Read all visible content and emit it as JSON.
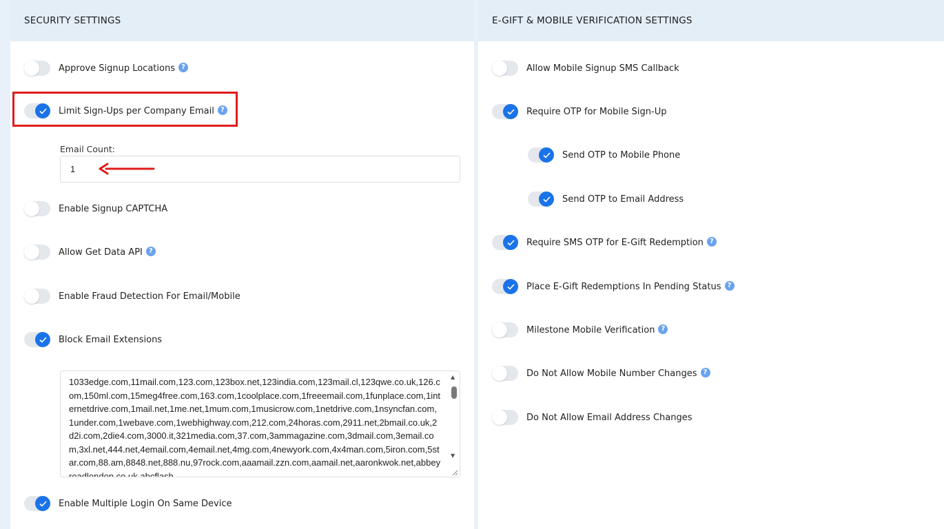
{
  "security": {
    "title": "SECURITY SETTINGS",
    "toggles": [
      {
        "label": "Approve Signup Locations",
        "on": false,
        "help": true
      },
      {
        "label": "Limit Sign-Ups per Company Email",
        "on": true,
        "help": true
      },
      {
        "label": "Enable Signup CAPTCHA",
        "on": false,
        "help": false
      },
      {
        "label": "Allow Get Data API",
        "on": false,
        "help": true
      },
      {
        "label": "Enable Fraud Detection For Email/Mobile",
        "on": false,
        "help": false
      },
      {
        "label": "Block Email Extensions",
        "on": true,
        "help": false
      },
      {
        "label": "Enable Multiple Login On Same Device",
        "on": true,
        "help": false
      }
    ],
    "email_count": {
      "label": "Email Count:",
      "value": "1"
    },
    "blocked_extensions": "1033edge.com,11mail.com,123.com,123box.net,123india.com,123mail.cl,123qwe.co.uk,126.com,150ml.com,15meg4free.com,163.com,1coolplace.com,1freeemail.com,1funplace.com,1internetdrive.com,1mail.net,1me.net,1mum.com,1musicrow.com,1netdrive.com,1nsyncfan.com,1under.com,1webave.com,1webhighway.com,212.com,24horas.com,2911.net,2bmail.co.uk,2d2i.com,2die4.com,3000.it,321media.com,37.com,3ammagazine.com,3dmail.com,3email.com,3xl.net,444.net,4email.com,4email.net,4mg.com,4newyork.com,4x4man.com,5iron.com,5star.com,88.am,8848.net,888.nu,97rock.com,aaamail.zzn.com,aamail.net,aaronkwok.net,abbeyroadlondon.co.uk,abcflash"
  },
  "verification": {
    "title": "E-GIFT & MOBILE VERIFICATION SETTINGS",
    "toggles": [
      {
        "label": "Allow Mobile Signup SMS Callback",
        "on": false,
        "help": false
      },
      {
        "label": "Require OTP for Mobile Sign-Up",
        "on": true,
        "help": false
      },
      {
        "label": "Send OTP to Mobile Phone",
        "on": true,
        "help": false
      },
      {
        "label": "Send OTP to Email Address",
        "on": true,
        "help": false
      },
      {
        "label": "Require SMS OTP for E-Gift Redemption",
        "on": true,
        "help": true
      },
      {
        "label": "Place E-Gift Redemptions In Pending Status",
        "on": true,
        "help": true
      },
      {
        "label": "Milestone Mobile Verification",
        "on": false,
        "help": true
      },
      {
        "label": "Do Not Allow Mobile Number Changes",
        "on": false,
        "help": true
      },
      {
        "label": "Do Not Allow Email Address Changes",
        "on": false,
        "help": false
      }
    ]
  },
  "help_glyph": "?",
  "colors": {
    "accent": "#1a73e8",
    "highlight": "#e01b1b",
    "header_bg": "#e3eef7"
  }
}
